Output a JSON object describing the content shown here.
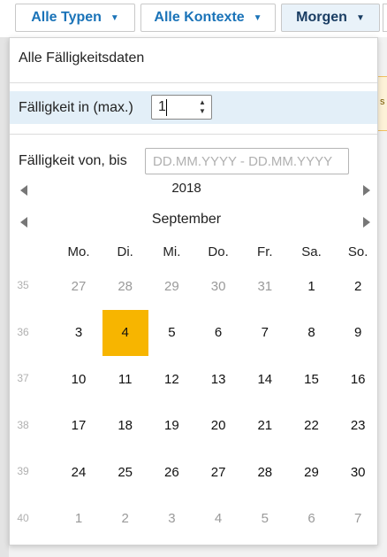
{
  "toolbar": {
    "types_label": "Alle Typen",
    "contexts_label": "Alle Kontexte",
    "due_label": "Morgen"
  },
  "panel": {
    "all_dates_label": "Alle Fälligkeitsdaten",
    "due_in_max_label": "Fälligkeit in (max.)",
    "due_in_max_value": "1",
    "due_range_label": "Fälligkeit von, bis",
    "due_range_placeholder": "DD.MM.YYYY - DD.MM.YYYY"
  },
  "background": {
    "partial_text": "s"
  },
  "calendar": {
    "year": "2018",
    "month": "September",
    "weekdays": [
      "Mo.",
      "Di.",
      "Mi.",
      "Do.",
      "Fr.",
      "Sa.",
      "So."
    ],
    "weeks": [
      {
        "kw": "35",
        "days": [
          {
            "d": "27",
            "other": true
          },
          {
            "d": "28",
            "other": true
          },
          {
            "d": "29",
            "other": true
          },
          {
            "d": "30",
            "other": true
          },
          {
            "d": "31",
            "other": true
          },
          {
            "d": "1"
          },
          {
            "d": "2"
          }
        ]
      },
      {
        "kw": "36",
        "days": [
          {
            "d": "3"
          },
          {
            "d": "4",
            "selected": true
          },
          {
            "d": "5"
          },
          {
            "d": "6"
          },
          {
            "d": "7"
          },
          {
            "d": "8"
          },
          {
            "d": "9"
          }
        ]
      },
      {
        "kw": "37",
        "days": [
          {
            "d": "10"
          },
          {
            "d": "11"
          },
          {
            "d": "12"
          },
          {
            "d": "13"
          },
          {
            "d": "14"
          },
          {
            "d": "15"
          },
          {
            "d": "16"
          }
        ]
      },
      {
        "kw": "38",
        "days": [
          {
            "d": "17"
          },
          {
            "d": "18"
          },
          {
            "d": "19"
          },
          {
            "d": "20"
          },
          {
            "d": "21"
          },
          {
            "d": "22"
          },
          {
            "d": "23"
          }
        ]
      },
      {
        "kw": "39",
        "days": [
          {
            "d": "24"
          },
          {
            "d": "25"
          },
          {
            "d": "26"
          },
          {
            "d": "27"
          },
          {
            "d": "28"
          },
          {
            "d": "29"
          },
          {
            "d": "30"
          }
        ]
      },
      {
        "kw": "40",
        "days": [
          {
            "d": "1",
            "other": true
          },
          {
            "d": "2",
            "other": true
          },
          {
            "d": "3",
            "other": true
          },
          {
            "d": "4",
            "other": true
          },
          {
            "d": "5",
            "other": true
          },
          {
            "d": "6",
            "other": true
          },
          {
            "d": "7",
            "other": true
          }
        ]
      }
    ]
  },
  "colors": {
    "accent": "#1a73b8",
    "selected_day": "#f7b500",
    "highlight_row": "#e3eff8"
  }
}
